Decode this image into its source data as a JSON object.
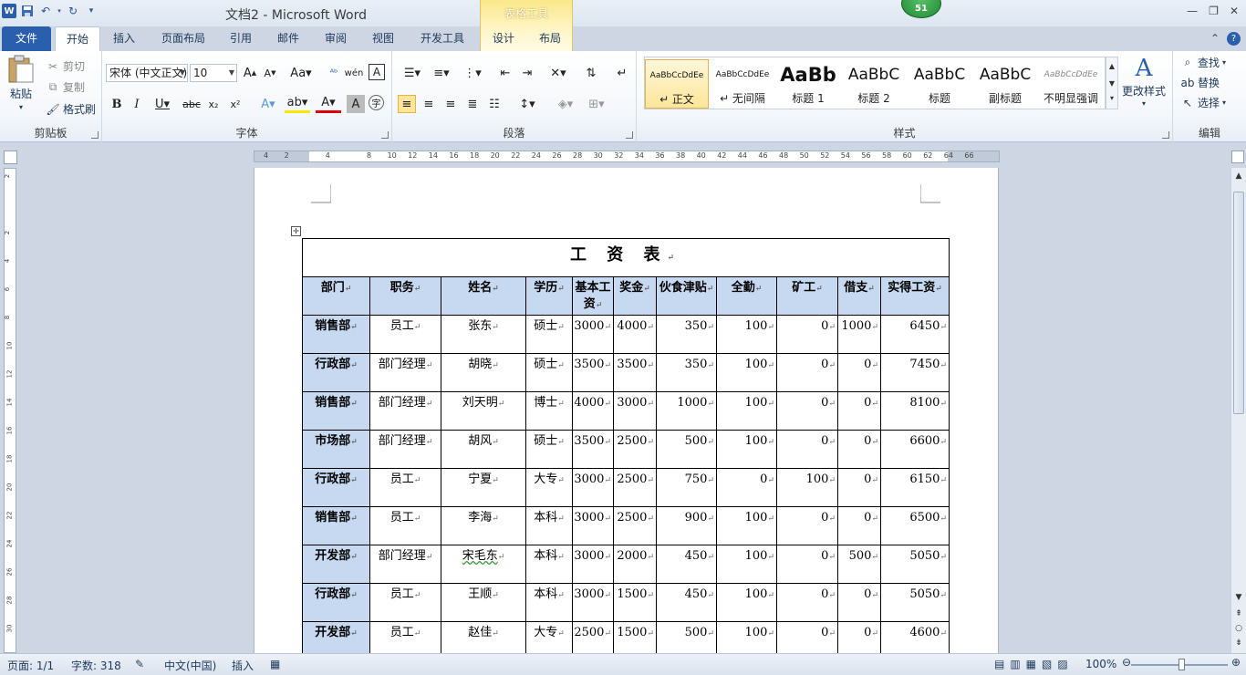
{
  "window": {
    "title": "文档2 - Microsoft Word",
    "context_group": "表格工具",
    "badge": "51"
  },
  "tabs": {
    "file": "文件",
    "home": "开始",
    "insert": "插入",
    "page_layout": "页面布局",
    "references": "引用",
    "mailings": "邮件",
    "review": "审阅",
    "view": "视图",
    "developer": "开发工具",
    "design": "设计",
    "layout": "布局"
  },
  "ribbon": {
    "clipboard": {
      "paste": "粘贴",
      "cut": "剪切",
      "copy": "复制",
      "format_painter": "格式刷",
      "label": "剪贴板"
    },
    "font": {
      "name": "宋体 (中文正文)",
      "size": "10",
      "label": "字体"
    },
    "paragraph": {
      "label": "段落"
    },
    "styles": {
      "items": [
        {
          "preview": "AaBbCcDdEe",
          "name": "↵ 正文"
        },
        {
          "preview": "AaBbCcDdEe",
          "name": "↵ 无间隔"
        },
        {
          "preview": "AaBb",
          "name": "标题 1"
        },
        {
          "preview": "AaBbC",
          "name": "标题 2"
        },
        {
          "preview": "AaBbC",
          "name": "标题"
        },
        {
          "preview": "AaBbC",
          "name": "副标题"
        },
        {
          "preview": "AaBbCcDdEe",
          "name": "不明显强调"
        }
      ],
      "change_styles": "更改样式",
      "label": "样式"
    },
    "editing": {
      "find": "查找",
      "replace": "替换",
      "select": "选择",
      "label": "编辑"
    }
  },
  "document": {
    "table_title": "工 资 表",
    "headers": [
      "部门",
      "职务",
      "姓名",
      "学历",
      "基本工资",
      "奖金",
      "伙食津贴",
      "全勤",
      "矿工",
      "借支",
      "实得工资"
    ],
    "rows": [
      [
        "销售部",
        "员工",
        "张东",
        "硕士",
        "3000",
        "4000",
        "350",
        "100",
        "0",
        "1000",
        "6450"
      ],
      [
        "行政部",
        "部门经理",
        "胡晓",
        "硕士",
        "3500",
        "3500",
        "350",
        "100",
        "0",
        "0",
        "7450"
      ],
      [
        "销售部",
        "部门经理",
        "刘天明",
        "博士",
        "4000",
        "3000",
        "1000",
        "100",
        "0",
        "0",
        "8100"
      ],
      [
        "市场部",
        "部门经理",
        "胡风",
        "硕士",
        "3500",
        "2500",
        "500",
        "100",
        "0",
        "0",
        "6600"
      ],
      [
        "行政部",
        "员工",
        "宁夏",
        "大专",
        "3000",
        "2500",
        "750",
        "0",
        "100",
        "0",
        "6150"
      ],
      [
        "销售部",
        "员工",
        "李海",
        "本科",
        "3000",
        "2500",
        "900",
        "100",
        "0",
        "0",
        "6500"
      ],
      [
        "开发部",
        "部门经理",
        "宋毛东",
        "本科",
        "3000",
        "2000",
        "450",
        "100",
        "0",
        "500",
        "5050"
      ],
      [
        "行政部",
        "员工",
        "王顺",
        "本科",
        "3000",
        "1500",
        "450",
        "100",
        "0",
        "0",
        "5050"
      ],
      [
        "开发部",
        "员工",
        "赵佳",
        "大专",
        "2500",
        "1500",
        "500",
        "100",
        "0",
        "0",
        "4600"
      ]
    ]
  },
  "status": {
    "page": "页面: 1/1",
    "words": "字数: 318",
    "language": "中文(中国)",
    "mode": "插入",
    "zoom": "100%"
  }
}
